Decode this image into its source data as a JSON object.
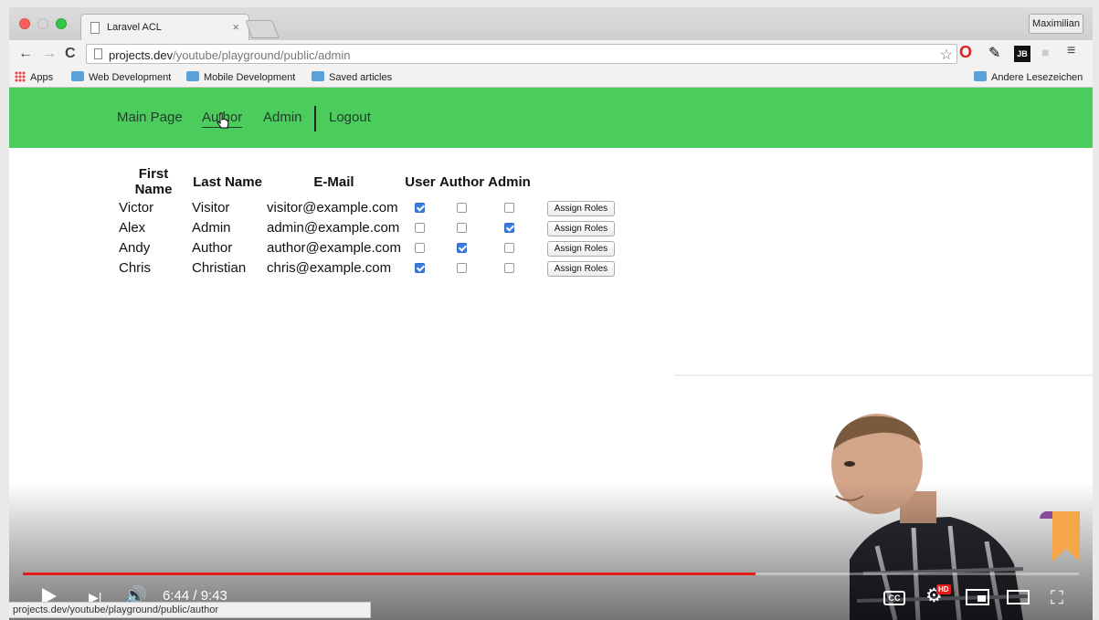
{
  "browser": {
    "tab_title": "Laravel ACL",
    "tab_close": "×",
    "profile_name": "Maximilian",
    "url_host": "projects.dev",
    "url_path": "/youtube/playground/public/admin",
    "back_glyph": "←",
    "forward_glyph": "→",
    "reload_glyph": "C",
    "star_glyph": "☆",
    "menu_glyph": "≡",
    "extensions": [
      "opera-icon",
      "dropper-tool-icon",
      "jetbrains-icon",
      "user-icon"
    ],
    "bookmarks": {
      "apps": "Apps",
      "items": [
        "Web Development",
        "Mobile Development",
        "Saved articles"
      ],
      "other": "Andere Lesezeichen"
    },
    "status_url": "projects.dev/youtube/playground/public/author"
  },
  "page": {
    "accent_color": "#4ccc5c",
    "nav": {
      "main": "Main Page",
      "author": "Author",
      "admin": "Admin",
      "logout": "Logout"
    },
    "table": {
      "headers": [
        "First Name",
        "Last Name",
        "E-Mail",
        "User",
        "Author",
        "Admin"
      ],
      "assign_label": "Assign Roles",
      "rows": [
        {
          "first": "Victor",
          "last": "Visitor",
          "email": "visitor@example.com",
          "user": true,
          "author": false,
          "admin": false
        },
        {
          "first": "Alex",
          "last": "Admin",
          "email": "admin@example.com",
          "user": false,
          "author": false,
          "admin": true
        },
        {
          "first": "Andy",
          "last": "Author",
          "email": "author@example.com",
          "user": false,
          "author": true,
          "admin": false
        },
        {
          "first": "Chris",
          "last": "Christian",
          "email": "chris@example.com",
          "user": true,
          "author": false,
          "admin": false
        }
      ]
    }
  },
  "video": {
    "time": "6:44 / 9:43",
    "progress": 0.694,
    "cc_label": "CC",
    "hd_label": "HD",
    "next_glyph": "▶|",
    "volume_glyph": "🔊",
    "gear_glyph": "⚙",
    "fullscreen_glyph": "⛶"
  }
}
